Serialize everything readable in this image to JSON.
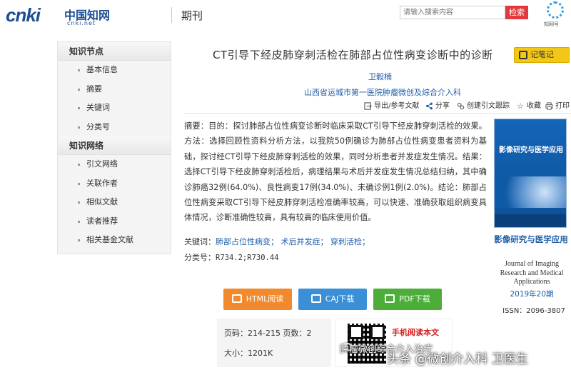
{
  "header": {
    "logo_brand": "cnki",
    "logo_cn": "中国知网",
    "logo_url": "cnki.net",
    "section": "期刊",
    "search_placeholder": "请输入搜索内容",
    "search_button": "检索",
    "brand_label": "知网号"
  },
  "sidebar": {
    "sections": [
      {
        "title": "知识节点",
        "items": [
          "基本信息",
          "摘要",
          "关键词",
          "分类号"
        ]
      },
      {
        "title": "知识网络",
        "items": [
          "引文网络",
          "关联作者",
          "相似文献",
          "读者推荐",
          "相关基金文献"
        ]
      }
    ]
  },
  "article": {
    "title": "CT引导下经皮肺穿刺活检在肺部占位性病变诊断中的诊断",
    "note_button": "记笔记",
    "author": "卫毅楠",
    "affiliation": "山西省运城市第一医院肿瘤微创及综合介入科",
    "toolbar": {
      "export": "导出/参考文献",
      "share": "分享",
      "citation": "创建引文跟踪",
      "favorite": "收藏",
      "print": "打印"
    },
    "abstract": "摘要：目的：探讨肺部占位性病变诊断时临床采取CT引导下经皮肺穿刺活检的效果。方法：选择回顾性资料分析方法，以我院50例确诊为肺部占位性病变患者资料为基础，探讨经CT引导下经皮肺穿刺活检的效果，同时分析患者并发症发生情况。结果：选择CT引导下经皮肺穿刺活检后，病理结果与术后并发症发生情况总结归纳，其中确诊肺癌32例(64.0%)、良性病变17例(34.0%)、未确诊例1例(2.0%)。结论：肺部占位性病变采取CT引导下经皮肺穿刺活检准确率较高，可以快速、准确获取组织病变具体情况，诊断准确性较高，具有较高的临床使用价值。",
    "keywords_label": "关键词：",
    "keywords": "肺部占位性病变； 术后并发症； 穿刺活检；",
    "classification_label": "分类号：",
    "classification": "R734.2;R730.44"
  },
  "journal": {
    "cover_title": "影像研究与医学应用",
    "name": "影像研究与医学应用",
    "name_en": "Journal of Imaging Research and Medical Applications",
    "issue": "2019年20期",
    "issn": "ISSN：2096-3807"
  },
  "downloads": {
    "html": "HTML阅读",
    "caj": "CAJ下载",
    "pdf": "PDF下载"
  },
  "info": {
    "pages": "页码：214-215  页数：2",
    "size": "大小：1201K"
  },
  "mobile": {
    "label": "手机阅读本文"
  },
  "watermarks": {
    "small": "肿瘤微创综合介入治疗",
    "large": "头条 @微创介入科 卫医生"
  },
  "colors": {
    "link_blue": "#1f5ea8",
    "search_red": "#e4393c",
    "note_yellow": "#f2c718",
    "html_orange": "#f08a2c",
    "caj_blue": "#3a8fd6",
    "pdf_green": "#4cae39"
  }
}
